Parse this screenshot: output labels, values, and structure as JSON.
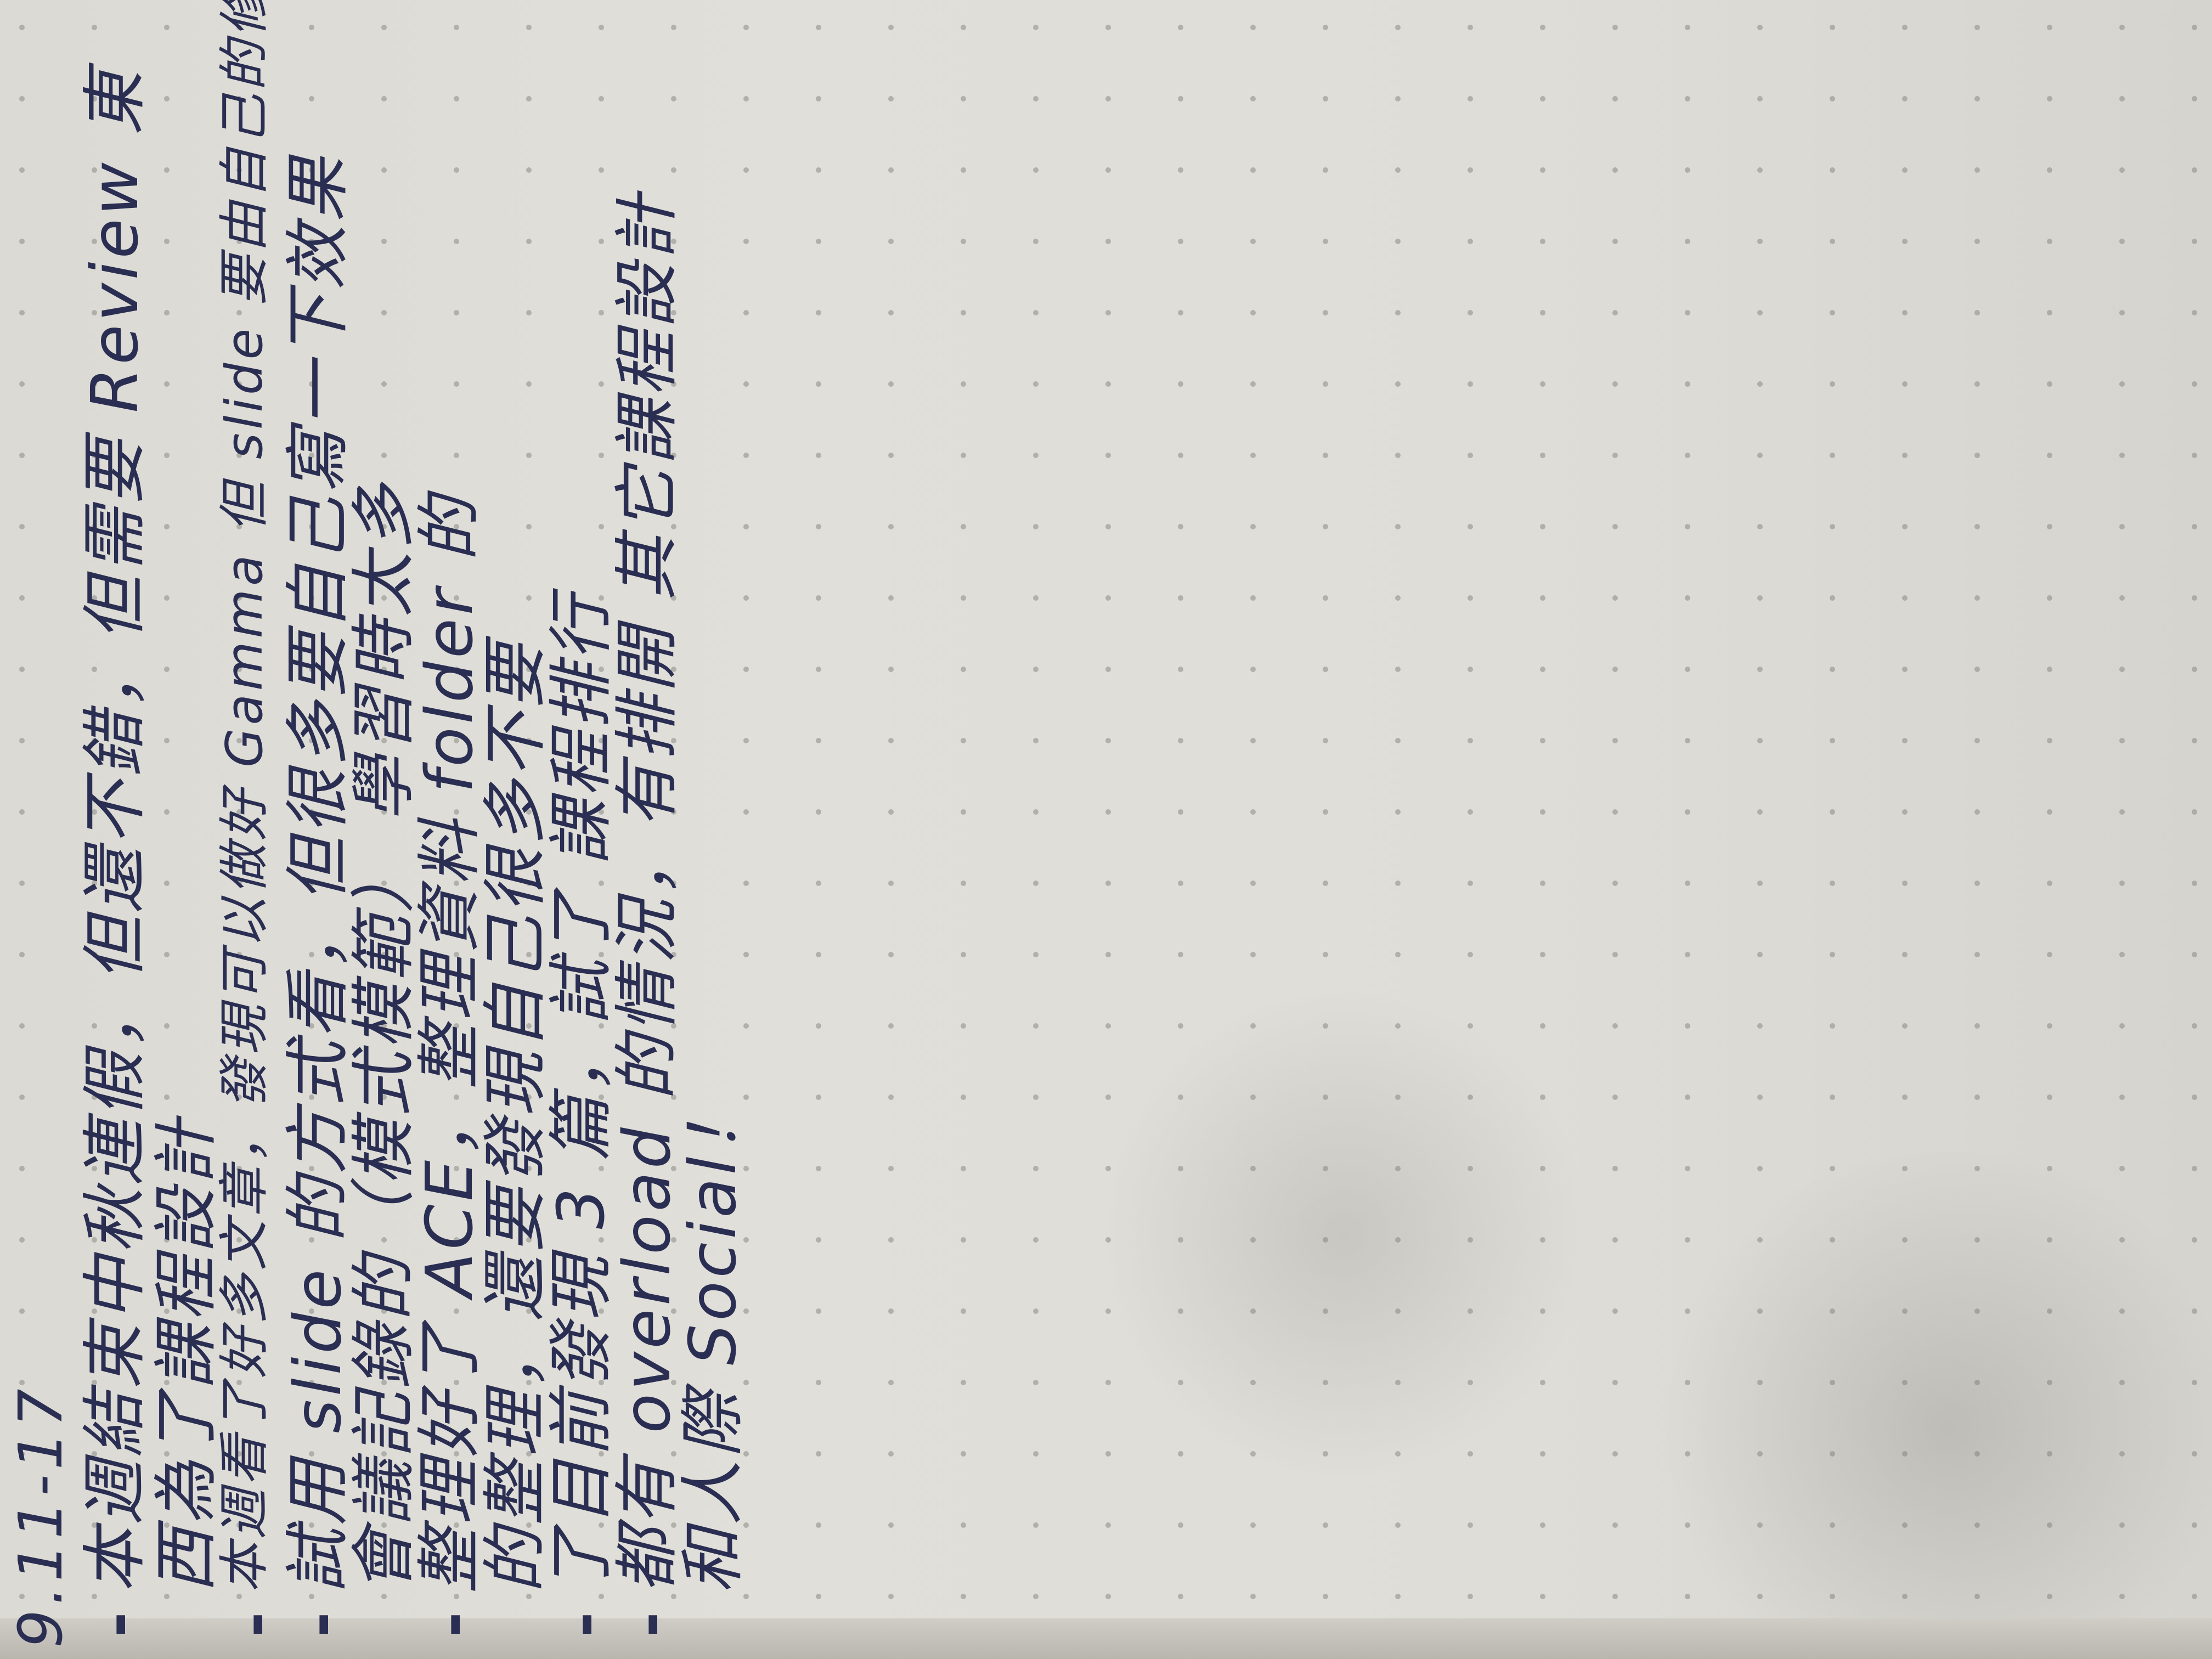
{
  "notebook": {
    "paper_color": "#dfddd7",
    "dot_color": "#8a8a86",
    "ink_color": "#2a2e52"
  },
  "note": {
    "date": "9.11-17",
    "lines": [
      {
        "bullet": "-",
        "text": "本週結束中秋連假，但還不錯，但需要 Review 東"
      },
      {
        "bullet": "",
        "text": "西為了課程設計"
      },
      {
        "bullet": "-",
        "text": "本週看了好多文章，發現可以做好 Gamma 但 slide 要由自己的修改（課程講座"
      },
      {
        "bullet": "-",
        "text": "試用 slide 的方式看，但很多要自己寫一下效果"
      },
      {
        "bullet": "",
        "text": "會議記錄的（模式模範） 學習時太多"
      },
      {
        "bullet": "-",
        "text": "整理好了 ACE，整理資料 folder 的"
      },
      {
        "bullet": "",
        "text": "的整理，還要發現自己很多不要"
      },
      {
        "bullet": "-",
        "text": "了目前發現 3 篇，試了 課程排行"
      },
      {
        "bullet": "-",
        "text": "都有 overload 的情況，有排開 其它課程設計"
      },
      {
        "bullet": "",
        "text": "和人際 Social！"
      }
    ]
  }
}
